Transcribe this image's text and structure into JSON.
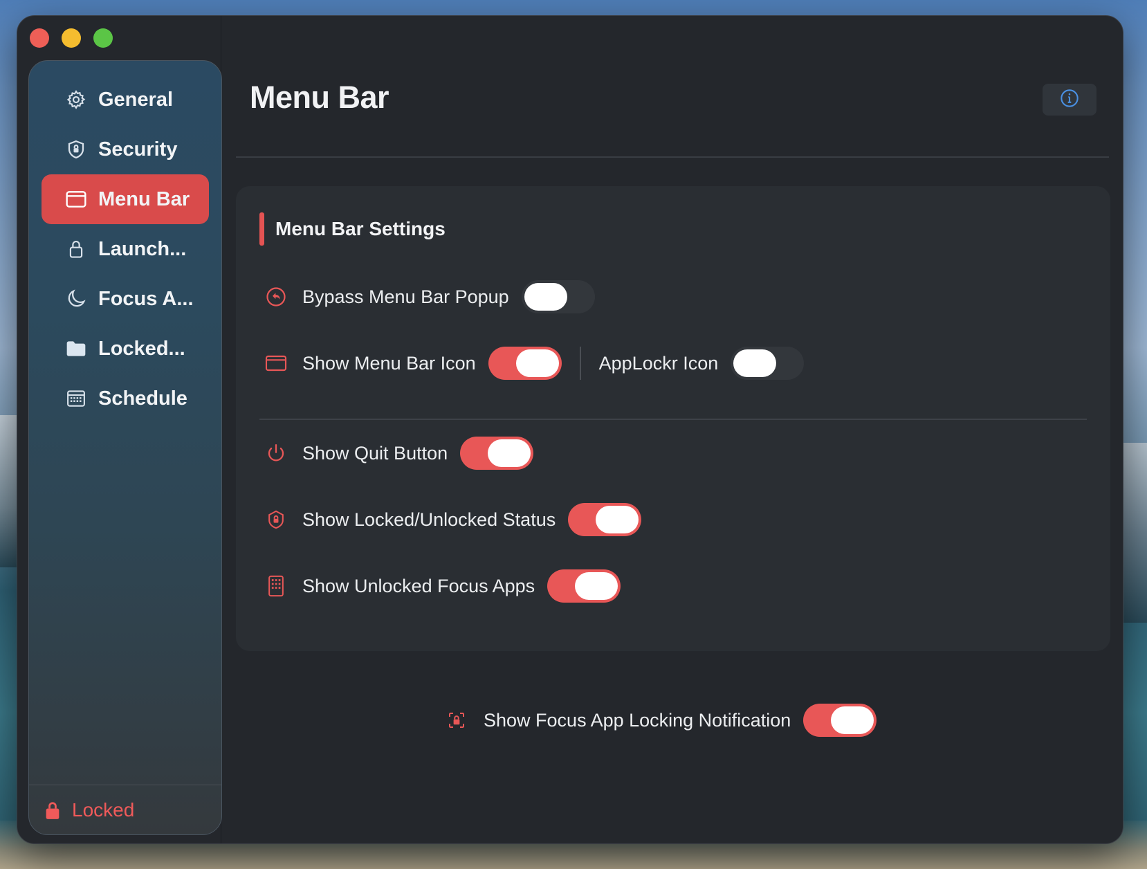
{
  "window": {
    "title": "Menu Bar"
  },
  "sidebar": {
    "items": [
      {
        "label": "General",
        "icon": "gear-icon",
        "active": false
      },
      {
        "label": "Security",
        "icon": "shield-icon",
        "active": false
      },
      {
        "label": "Menu Bar",
        "icon": "window-icon",
        "active": true
      },
      {
        "label": "Launch...",
        "icon": "lock-icon",
        "active": false
      },
      {
        "label": "Focus A...",
        "icon": "moon-icon",
        "active": false
      },
      {
        "label": "Locked...",
        "icon": "folder-icon",
        "active": false
      },
      {
        "label": "Schedule",
        "icon": "calendar-icon",
        "active": false
      }
    ],
    "footer": {
      "label": "Locked",
      "icon": "lock-icon"
    }
  },
  "main": {
    "title": "Menu Bar",
    "card": {
      "title": "Menu Bar Settings",
      "rows": {
        "bypass": {
          "label": "Bypass Menu Bar Popup",
          "on": false
        },
        "show_icon": {
          "label": "Show Menu Bar Icon",
          "on": true
        },
        "applockr_icon": {
          "label": "AppLockr Icon",
          "on": false
        },
        "quit": {
          "label": "Show Quit Button",
          "on": true
        },
        "status": {
          "label": "Show Locked/Unlocked Status",
          "on": true
        },
        "focus_apps": {
          "label": "Show Unlocked Focus Apps",
          "on": true
        }
      }
    },
    "notification": {
      "label": "Show Focus App Locking Notification",
      "on": true
    }
  },
  "colors": {
    "accent": "#e85757",
    "background": "#24272c",
    "info": "#4a90e2"
  }
}
